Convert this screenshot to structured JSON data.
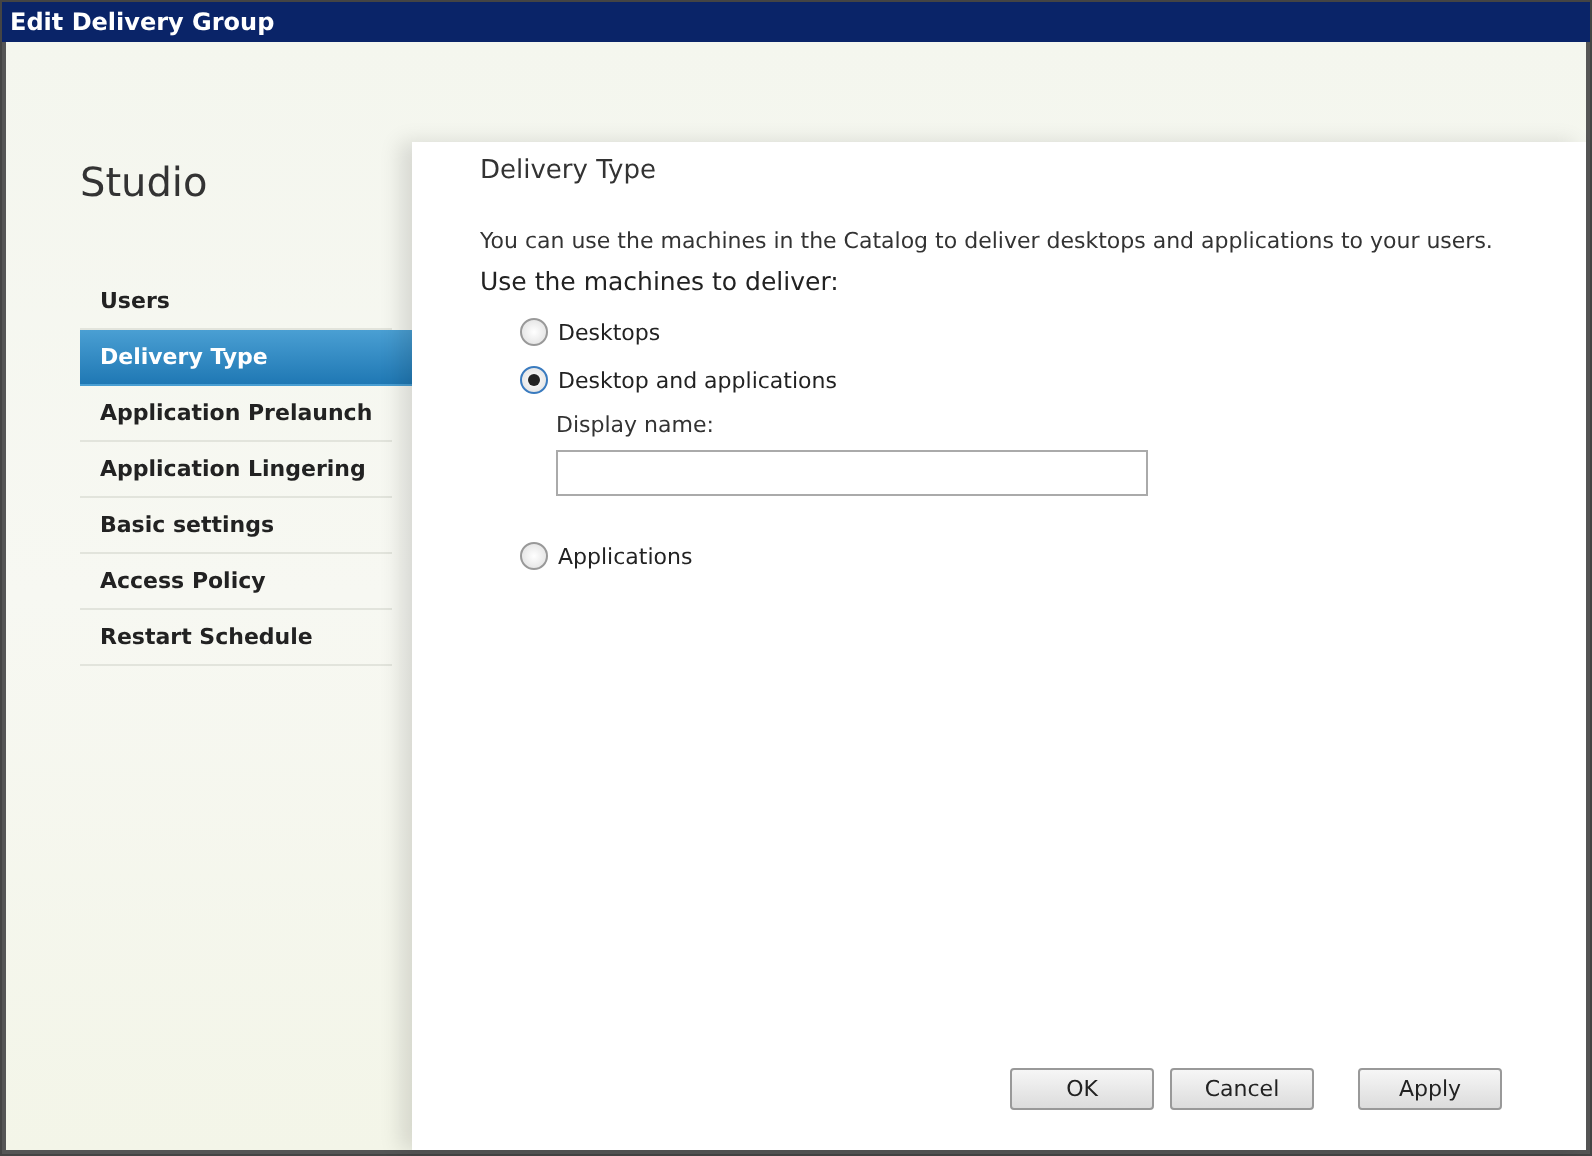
{
  "window": {
    "title": "Edit Delivery Group"
  },
  "sidebar": {
    "title": "Studio",
    "items": [
      {
        "label": "Users",
        "selected": false
      },
      {
        "label": "Delivery Type",
        "selected": true
      },
      {
        "label": "Application Prelaunch",
        "selected": false
      },
      {
        "label": "Application Lingering",
        "selected": false
      },
      {
        "label": "Basic settings",
        "selected": false
      },
      {
        "label": "Access Policy",
        "selected": false
      },
      {
        "label": "Restart Schedule",
        "selected": false
      }
    ]
  },
  "content": {
    "heading": "Delivery Type",
    "intro": "You can use the machines in the Catalog to deliver desktops and applications to your users.",
    "prompt": "Use the machines to deliver:",
    "options": [
      {
        "label": "Desktops",
        "selected": false
      },
      {
        "label": "Desktop and applications",
        "selected": true,
        "field": {
          "label": "Display name:"
        }
      },
      {
        "label": "Applications",
        "selected": false
      }
    ]
  },
  "buttons": [
    {
      "label": "OK"
    },
    {
      "label": "Cancel"
    },
    {
      "label": "Apply"
    }
  ]
}
